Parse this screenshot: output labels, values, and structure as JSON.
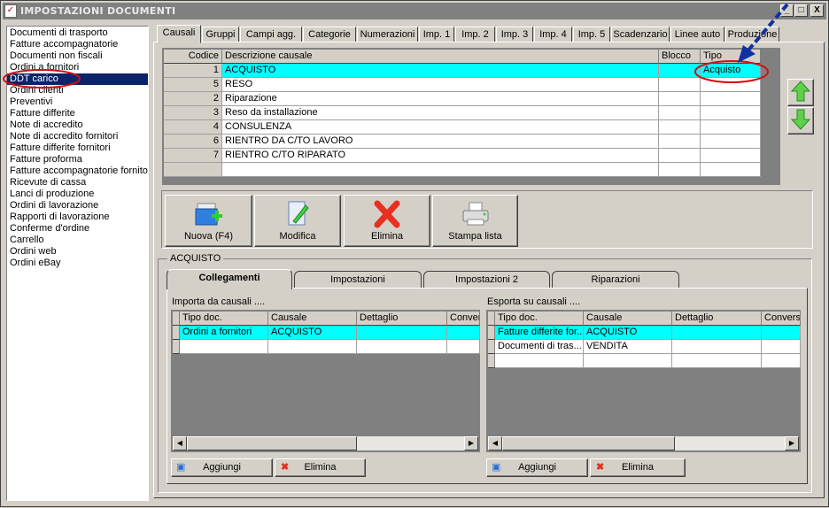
{
  "window": {
    "title": "IMPOSTAZIONI DOCUMENTI",
    "minimize": "_",
    "maximize": "□",
    "close": "X"
  },
  "sidebar": {
    "items": [
      "Documenti di trasporto",
      "Fatture accompagnatorie",
      "Documenti non fiscali",
      "Ordini a fornitori",
      "DDT carico",
      "Ordini clienti",
      "Preventivi",
      "Fatture differite",
      "Note di accredito",
      "Note di accredito fornitori",
      "Fatture differite fornitori",
      "Fatture proforma",
      "Fatture accompagnatorie fornitori",
      "Ricevute di cassa",
      "Lanci di produzione",
      "Ordini di lavorazione",
      "Rapporti di lavorazione",
      "Conferme d'ordine",
      "Carrello",
      "Ordini web",
      "Ordini eBay"
    ],
    "selected": 4
  },
  "tabs": [
    "Causali",
    "Gruppi",
    "Campi agg.",
    "Categorie",
    "Numerazioni",
    "Imp. 1",
    "Imp. 2",
    "Imp. 3",
    "Imp. 4",
    "Imp. 5",
    "Scadenzario",
    "Linee auto",
    "Produzione"
  ],
  "causali": {
    "headers": [
      "Codice",
      "Descrizione causale",
      "Blocco",
      "Tipo"
    ],
    "rows": [
      [
        "1",
        "ACQUISTO",
        "",
        "Acquisto"
      ],
      [
        "5",
        "RESO",
        "",
        ""
      ],
      [
        "2",
        "Riparazione",
        "",
        ""
      ],
      [
        "3",
        "Reso da installazione",
        "",
        ""
      ],
      [
        "4",
        "CONSULENZA",
        "",
        ""
      ],
      [
        "6",
        "RIENTRO DA C/TO LAVORO",
        "",
        ""
      ],
      [
        "7",
        "RIENTRO C/TO RIPARATO",
        "",
        ""
      ],
      [
        "",
        "",
        "",
        ""
      ]
    ],
    "selected": 0
  },
  "toolbar": {
    "nuova": "Nuova (F4)",
    "modifica": "Modifica",
    "elimina": "Elimina",
    "stampa": "Stampa lista"
  },
  "group": {
    "title": "ACQUISTO",
    "subtabs": [
      "Collegamenti",
      "Impostazioni",
      "Impostazioni 2",
      "Riparazioni"
    ],
    "importa": {
      "label": "Importa da causali ....",
      "headers": [
        "Tipo doc.",
        "Causale",
        "Dettaglio",
        "Conver"
      ],
      "rows": [
        [
          "Ordini a fornitori",
          "ACQUISTO",
          "",
          ""
        ],
        [
          "",
          "",
          "",
          ""
        ]
      ]
    },
    "esporta": {
      "label": "Esporta su causali ....",
      "headers": [
        "Tipo doc.",
        "Causale",
        "Dettaglio",
        "Conversi"
      ],
      "rows": [
        [
          "Fatture differite for...",
          "ACQUISTO",
          "",
          ""
        ],
        [
          "Documenti di tras...",
          "VENDITA",
          "",
          ""
        ],
        [
          "",
          "",
          "",
          ""
        ]
      ]
    },
    "aggiungi": "Aggiungi",
    "elimina": "Elimina"
  },
  "colors": {
    "selection": "#00ffff",
    "listSelection": "#0a246a",
    "annotation": "#d01010",
    "arrow": "#1030a0"
  }
}
